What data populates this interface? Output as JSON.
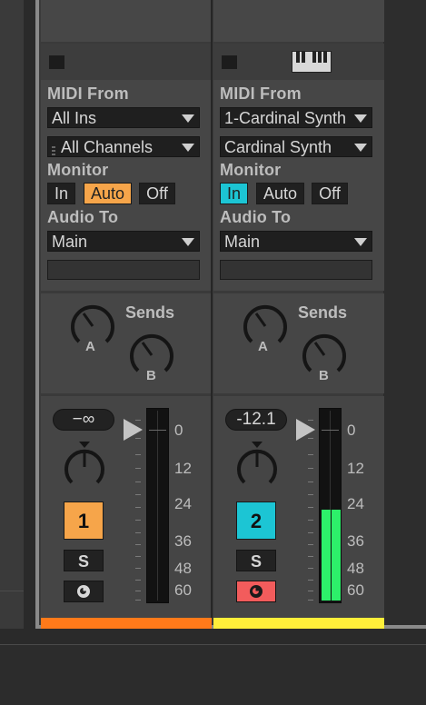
{
  "tracks": [
    {
      "midi_from_label": "MIDI From",
      "midi_from_value": "All Ins",
      "channel_value": "All Channels",
      "monitor_label": "Monitor",
      "monitor_options": [
        "In",
        "Auto",
        "Off"
      ],
      "monitor_active": "Auto",
      "audio_to_label": "Audio To",
      "audio_to_value": "Main",
      "sends_label": "Sends",
      "send_a": "A",
      "send_b": "B",
      "volume": "−∞",
      "db_scale": [
        "0",
        "12",
        "24",
        "36",
        "48",
        "60"
      ],
      "track_number": "1",
      "track_color": "#f6a54a",
      "strip_color": "#ff7a1a",
      "solo_label": "S",
      "meter_level": 0,
      "armed": false,
      "has_instrument_icon": false
    },
    {
      "midi_from_label": "MIDI From",
      "midi_from_value": "1-Cardinal Synth",
      "channel_value": "Cardinal Synth",
      "monitor_label": "Monitor",
      "monitor_options": [
        "In",
        "Auto",
        "Off"
      ],
      "monitor_active": "In",
      "audio_to_label": "Audio To",
      "audio_to_value": "Main",
      "sends_label": "Sends",
      "send_a": "A",
      "send_b": "B",
      "volume": "-12.1",
      "db_scale": [
        "0",
        "12",
        "24",
        "36",
        "48",
        "60"
      ],
      "track_number": "2",
      "track_color": "#1cc5d4",
      "strip_color": "#ffef3a",
      "solo_label": "S",
      "meter_level": 0.48,
      "armed": true,
      "has_instrument_icon": true
    }
  ],
  "icons": [
    "clip-stop-icon",
    "piano-icon",
    "dropdown-arrow-icon",
    "pan-knob-icon",
    "send-knob-icon",
    "fader-triangle-icon",
    "arm-record-icon"
  ]
}
